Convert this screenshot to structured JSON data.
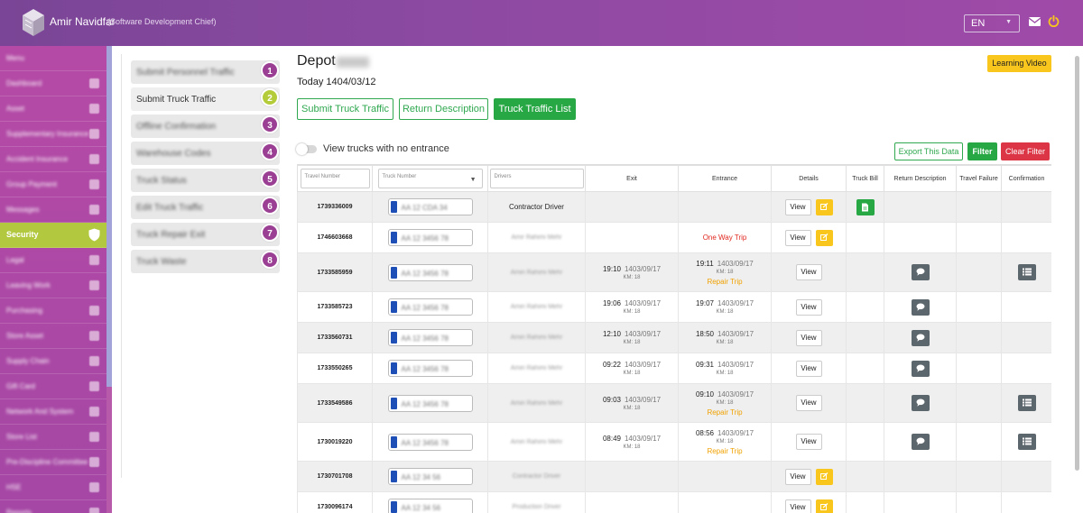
{
  "header": {
    "user_name": "Amir Navidfar",
    "user_role": "(Software Development Chief)",
    "language": "EN"
  },
  "sidebar": {
    "items": [
      {
        "label": "Menu",
        "active": false
      },
      {
        "label": "Dashboard",
        "active": false
      },
      {
        "label": "Asset",
        "active": false
      },
      {
        "label": "Supplementary Insurance",
        "active": false
      },
      {
        "label": "Accident Insurance",
        "active": false
      },
      {
        "label": "Group Payment",
        "active": false
      },
      {
        "label": "Messages",
        "active": false
      },
      {
        "label": "Security",
        "active": true
      },
      {
        "label": "Legal",
        "active": false
      },
      {
        "label": "Leaving Work",
        "active": false
      },
      {
        "label": "Purchasing",
        "active": false
      },
      {
        "label": "Store Asset",
        "active": false
      },
      {
        "label": "Supply Chain",
        "active": false
      },
      {
        "label": "Gift Card",
        "active": false
      },
      {
        "label": "Network And System",
        "active": false
      },
      {
        "label": "Store List",
        "active": false
      },
      {
        "label": "Pre-Discipline Committee",
        "active": false
      },
      {
        "label": "HSE",
        "active": false
      },
      {
        "label": "Reports",
        "active": false
      }
    ]
  },
  "steps": [
    {
      "number": "1",
      "label": "Submit Personnel Traffic",
      "active": false
    },
    {
      "number": "2",
      "label": "Submit Truck Traffic",
      "active": true
    },
    {
      "number": "3",
      "label": "Offline Confirmation",
      "active": false
    },
    {
      "number": "4",
      "label": "Warehouse Codes",
      "active": false
    },
    {
      "number": "5",
      "label": "Truck Status",
      "active": false
    },
    {
      "number": "6",
      "label": "Edit Truck Traffic",
      "active": false
    },
    {
      "number": "7",
      "label": "Truck Repair Exit",
      "active": false
    },
    {
      "number": "8",
      "label": "Truck Waste",
      "active": false
    }
  ],
  "main": {
    "title": "Depot",
    "today": "Today 1404/03/12",
    "learning_video": "Learning Video",
    "tabs": {
      "submit": "Submit Truck Traffic",
      "return_desc": "Return Description",
      "list": "Truck Traffic List"
    },
    "toggle_label": "View trucks with no entrance",
    "export_label": "Export This Data",
    "filter_label": "Filter",
    "clear_filter_label": "Clear Filter"
  },
  "table": {
    "filters": {
      "travel_number": "Travel Number",
      "truck_number": "Truck Number",
      "drivers": "Drivers"
    },
    "columns": {
      "exit": "Exit",
      "entrance": "Entrance",
      "details": "Details",
      "truck_bill": "Truck Bill",
      "return_description": "Return Description",
      "travel_failure": "Travel Failure",
      "confirmation": "Confirmation"
    },
    "view_label": "View",
    "rows": [
      {
        "travel": "1739336009",
        "plate": "AA 12 CDA 34",
        "driver": "Contractor Driver",
        "driver_blur": false,
        "exit_time": "",
        "exit_date": "",
        "exit_km": "",
        "entry_time": "",
        "entry_date": "",
        "entry_km": "",
        "entry_note": "",
        "edit": true,
        "bill": true,
        "return_desc": false,
        "confirm": false
      },
      {
        "travel": "1746603668",
        "plate": "AA 12 3456 78",
        "driver": "Amir Rahimi Mehr",
        "driver_blur": true,
        "exit_time": "",
        "exit_date": "",
        "exit_km": "",
        "entry_time": "",
        "entry_date": "",
        "entry_km": "",
        "entry_note": "One Way Trip",
        "edit": true,
        "bill": false,
        "return_desc": false,
        "confirm": false
      },
      {
        "travel": "1733585959",
        "plate": "AA 12 3456 78",
        "driver": "Amiri Rahimi Mehr",
        "driver_blur": true,
        "exit_time": "19:10",
        "exit_date": "1403/09/17",
        "exit_km": "KM: 18",
        "entry_time": "19:11",
        "entry_date": "1403/09/17",
        "entry_km": "KM: 18",
        "entry_note": "Repair Trip",
        "edit": false,
        "bill": false,
        "return_desc": true,
        "confirm": true
      },
      {
        "travel": "1733585723",
        "plate": "AA 12 3456 78",
        "driver": "Amiri Rahimi Mehr",
        "driver_blur": true,
        "exit_time": "19:06",
        "exit_date": "1403/09/17",
        "exit_km": "KM: 18",
        "entry_time": "19:07",
        "entry_date": "1403/09/17",
        "entry_km": "KM: 18",
        "entry_note": "",
        "edit": false,
        "bill": false,
        "return_desc": true,
        "confirm": false
      },
      {
        "travel": "1733560731",
        "plate": "AA 12 3456 78",
        "driver": "Amiri Rahimi Mehr",
        "driver_blur": true,
        "exit_time": "12:10",
        "exit_date": "1403/09/17",
        "exit_km": "KM: 18",
        "entry_time": "18:50",
        "entry_date": "1403/09/17",
        "entry_km": "KM: 18",
        "entry_note": "",
        "edit": false,
        "bill": false,
        "return_desc": true,
        "confirm": false
      },
      {
        "travel": "1733550265",
        "plate": "AA 12 3456 78",
        "driver": "Amiri Rahimi Mehr",
        "driver_blur": true,
        "exit_time": "09:22",
        "exit_date": "1403/09/17",
        "exit_km": "KM: 18",
        "entry_time": "09:31",
        "entry_date": "1403/09/17",
        "entry_km": "KM: 18",
        "entry_note": "",
        "edit": false,
        "bill": false,
        "return_desc": true,
        "confirm": false
      },
      {
        "travel": "1733549586",
        "plate": "AA 12 3456 78",
        "driver": "Amiri Rahimi Mehr",
        "driver_blur": true,
        "exit_time": "09:03",
        "exit_date": "1403/09/17",
        "exit_km": "KM: 18",
        "entry_time": "09:10",
        "entry_date": "1403/09/17",
        "entry_km": "KM: 18",
        "entry_note": "Repair Trip",
        "edit": false,
        "bill": false,
        "return_desc": true,
        "confirm": true
      },
      {
        "travel": "1730019220",
        "plate": "AA 12 3456 78",
        "driver": "Amiri Rahimi Mehr",
        "driver_blur": true,
        "exit_time": "08:49",
        "exit_date": "1403/09/17",
        "exit_km": "KM: 18",
        "entry_time": "08:56",
        "entry_date": "1403/09/17",
        "entry_km": "KM: 18",
        "entry_note": "Repair Trip",
        "edit": false,
        "bill": false,
        "return_desc": true,
        "confirm": true
      },
      {
        "travel": "1730701708",
        "plate": "AA 12 34 56",
        "driver": "Contractor Driver",
        "driver_blur": true,
        "exit_time": "",
        "exit_date": "",
        "exit_km": "",
        "entry_time": "",
        "entry_date": "",
        "entry_km": "",
        "entry_note": "",
        "edit": true,
        "bill": false,
        "return_desc": false,
        "confirm": false
      },
      {
        "travel": "1730096174",
        "plate": "AA 12 34 56",
        "driver": "Production Driver",
        "driver_blur": true,
        "exit_time": "",
        "exit_date": "",
        "exit_km": "",
        "entry_time": "",
        "entry_date": "",
        "entry_km": "",
        "entry_note": "",
        "edit": true,
        "bill": false,
        "return_desc": false,
        "confirm": false
      }
    ]
  }
}
